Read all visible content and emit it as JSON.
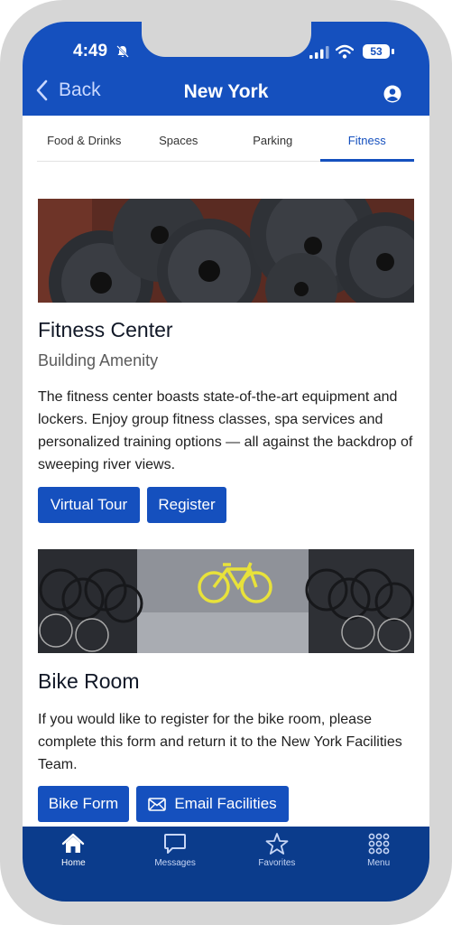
{
  "status": {
    "time": "4:49",
    "battery": "53"
  },
  "header": {
    "back_label": "Back",
    "title": "New York"
  },
  "tabs": [
    {
      "label": "Food & Drinks"
    },
    {
      "label": "Spaces"
    },
    {
      "label": "Parking"
    },
    {
      "label": "Fitness"
    }
  ],
  "fitness": {
    "title": "Fitness Center",
    "subtitle": "Building Amenity",
    "description": "The fitness center boasts state-of-the-art equipment and lockers. Enjoy group fitness classes, spa services and personalized training options — all against the backdrop of sweeping river views.",
    "btn_virtual_tour": "Virtual Tour",
    "btn_register": "Register"
  },
  "bike": {
    "title": "Bike Room",
    "description": "If you would like to register for the bike room, please complete this form and return it to the New York Facilities Team.",
    "btn_bike_form": "Bike Form",
    "btn_email": "Email Facilities"
  },
  "bottom_nav": [
    {
      "label": "Home",
      "icon": "home-icon"
    },
    {
      "label": "Messages",
      "icon": "chat-icon"
    },
    {
      "label": "Favorites",
      "icon": "star-icon"
    },
    {
      "label": "Menu",
      "icon": "grid-icon"
    }
  ],
  "colors": {
    "primary": "#1550be",
    "nav_bg": "#0b3c8c"
  }
}
